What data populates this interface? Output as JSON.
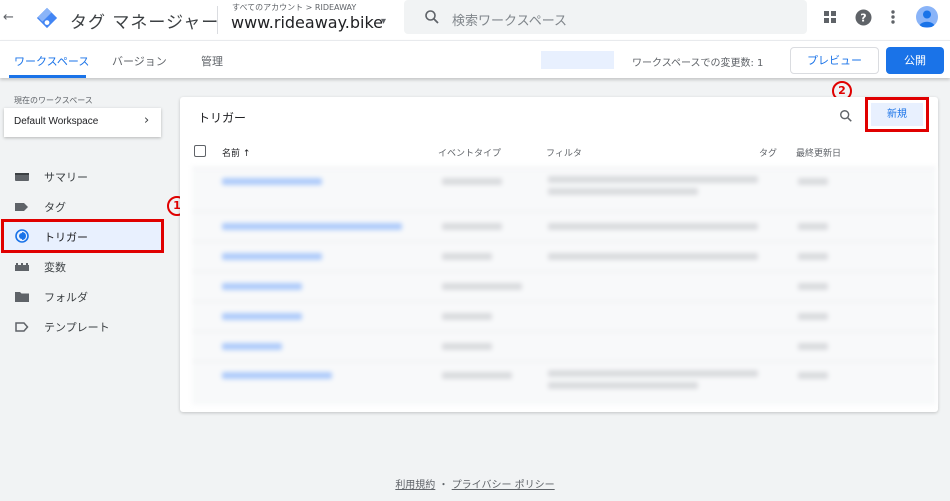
{
  "header": {
    "back_glyph": "←",
    "product_name": "タグ マネージャー",
    "account_breadcrumb": "すべてのアカウント > RIDEAWAY",
    "container_name": "www.rideaway.bike",
    "search_placeholder": "検索ワークスペース",
    "icons": [
      "back-arrow-icon",
      "gtm-logo-icon",
      "search-icon",
      "apps-grid-icon",
      "help-icon",
      "more-vert-icon",
      "account-avatar-icon"
    ]
  },
  "tabs": {
    "workspace": "ワークスペース",
    "versions": "バージョン",
    "admin": "管理"
  },
  "toolbar": {
    "changes_label": "ワークスペースでの変更数: 1",
    "preview": "プレビュー",
    "publish": "公開"
  },
  "sidebar": {
    "current_workspace_label": "現在のワークスペース",
    "workspace_name": "Default Workspace",
    "items": [
      {
        "label": "サマリー",
        "icon": "overview-icon"
      },
      {
        "label": "タグ",
        "icon": "tag-icon"
      },
      {
        "label": "トリガー",
        "icon": "trigger-icon"
      },
      {
        "label": "変数",
        "icon": "variables-icon"
      },
      {
        "label": "フォルダ",
        "icon": "folder-icon"
      },
      {
        "label": "テンプレート",
        "icon": "template-icon"
      }
    ]
  },
  "annotations": {
    "marker_1": "1",
    "marker_2": "2"
  },
  "triggers": {
    "title": "トリガー",
    "new_button": "新規",
    "columns": {
      "name": "名前 ↑",
      "event_type": "イベントタイプ",
      "filter": "フィルタ",
      "tags": "タグ",
      "last_modified": "最終更新日"
    }
  },
  "footer": {
    "terms": "利用規約",
    "separator": "・",
    "privacy": "プライバシー ポリシー"
  },
  "colors": {
    "accent": "#1a73e8",
    "highlight_red": "#e00000",
    "active_nav_bg": "#e8f0fe"
  }
}
